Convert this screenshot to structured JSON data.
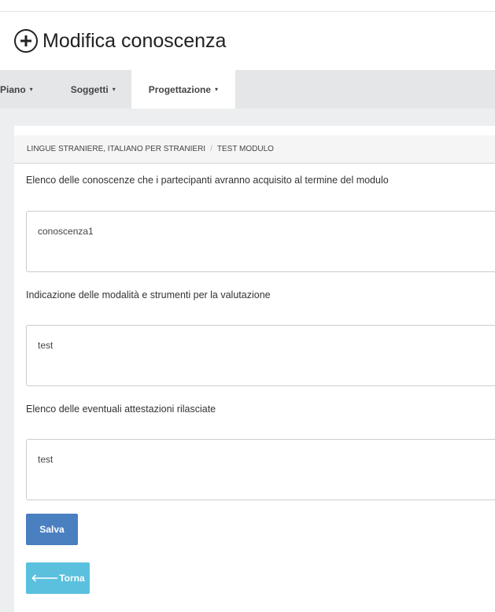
{
  "header": {
    "title": "Modifica conoscenza",
    "icon": "plus-circle-icon"
  },
  "nav": {
    "items": [
      {
        "label": "Piano",
        "caret": "▾"
      },
      {
        "label": "Soggetti",
        "caret": "▾"
      },
      {
        "label": "Progettazione",
        "caret": "▾",
        "active": true
      }
    ]
  },
  "breadcrumb": {
    "items": [
      "LINGUE STRANIERE, ITALIANO PER STRANIERI",
      "TEST MODULO"
    ],
    "separator": "/"
  },
  "form": {
    "fields": [
      {
        "label": "Elenco delle conoscenze che i partecipanti avranno acquisito al termine del modulo",
        "value": "conoscenza1"
      },
      {
        "label": "Indicazione delle modalità e strumenti per la valutazione",
        "value": "test"
      },
      {
        "label": "Elenco delle eventuali attestazioni rilasciate",
        "value": "test"
      }
    ],
    "save_label": "Salva",
    "back_label": "Torna",
    "back_icon": "arrow-left-icon"
  },
  "colors": {
    "save_button": "#4a7fc0",
    "back_button": "#5bc0de",
    "navbar": "#e4e6e8",
    "content_bg": "#eceef0"
  }
}
